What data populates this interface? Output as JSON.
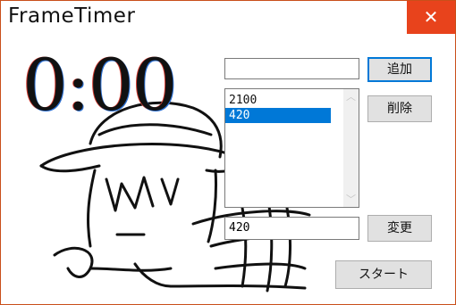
{
  "window": {
    "title": "FrameTimer",
    "close_glyph": "✕",
    "accent": "#e8431c"
  },
  "timer": {
    "display": "0:00"
  },
  "controls": {
    "top_input_value": "",
    "add_label": "追加",
    "delete_label": "削除",
    "edit_input_value": "420",
    "change_label": "変更",
    "start_label": "スタート"
  },
  "list": {
    "items": [
      {
        "label": "2100",
        "selected": false
      },
      {
        "label": "420",
        "selected": true
      }
    ],
    "selection_color": "#0078d7"
  },
  "illustration": {
    "icon": "character-doodle"
  }
}
